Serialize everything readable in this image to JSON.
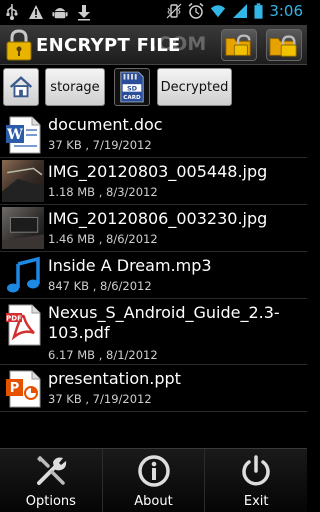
{
  "status_bar": {
    "time": "3:06",
    "left_icons": [
      "usb-icon",
      "warning-icon",
      "android-icon",
      "download-icon"
    ],
    "right_icons": [
      "vibrate-icon",
      "alarm-icon",
      "wifi-icon",
      "signal-icon",
      "battery-icon"
    ]
  },
  "title_bar": {
    "title": "ENCRYPT FILE",
    "watermark": ".COM",
    "buttons": [
      "unlock-folder-button",
      "lock-folder-button"
    ]
  },
  "nav": {
    "home_icon": "home-icon",
    "storage_label": "storage",
    "sdcard_icon": "sd-card-icon",
    "decrypted_label": "Decrypted"
  },
  "files": [
    {
      "name": "document.doc",
      "meta": "37 KB , 7/19/2012",
      "icon": "word-doc-icon"
    },
    {
      "name": "IMG_20120803_005448.jpg",
      "meta": "1.18 MB , 8/3/2012",
      "icon": "image-thumbnail"
    },
    {
      "name": "IMG_20120806_003230.jpg",
      "meta": "1.46 MB , 8/6/2012",
      "icon": "image-thumbnail"
    },
    {
      "name": "Inside A Dream.mp3",
      "meta": "847 KB , 8/6/2012",
      "icon": "music-note-icon"
    },
    {
      "name": "Nexus_S_Android_Guide_2.3-103.pdf",
      "meta": "6.17 MB , 8/1/2012",
      "icon": "pdf-icon"
    },
    {
      "name": "presentation.ppt",
      "meta": "37 KB , 7/19/2012",
      "icon": "powerpoint-icon"
    }
  ],
  "bottom_bar": {
    "options_label": "Options",
    "about_label": "About",
    "exit_label": "Exit"
  },
  "colors": {
    "clock": "#33b5e5",
    "background": "#000000",
    "nav_button": "#e6e6e6"
  }
}
